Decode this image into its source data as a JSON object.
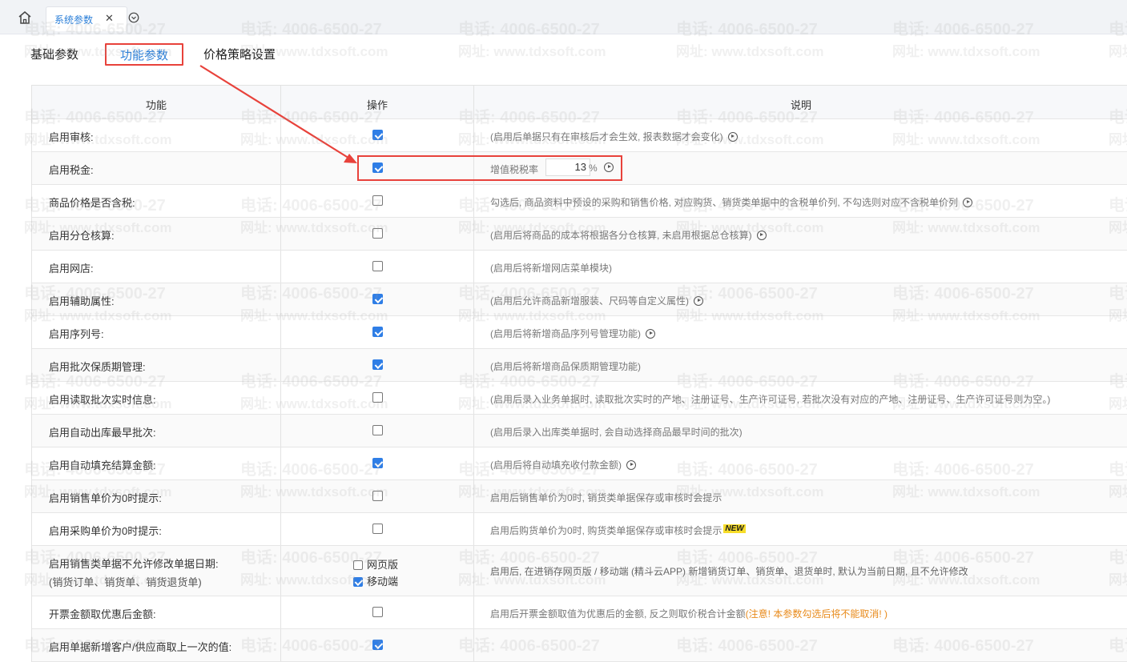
{
  "tabbar": {
    "home_icon": "home-icon",
    "active_tab": "系统参数",
    "close_icon": "close-icon",
    "dropdown_icon": "chevron-down-circle-icon"
  },
  "subtabs": [
    "基础参数",
    "功能参数",
    "价格策略设置"
  ],
  "table": {
    "headers": [
      "功能",
      "操作",
      "说明"
    ],
    "rows": [
      {
        "feature": "启用审核:",
        "checked": true,
        "desc": "(启用后单据只有在审核后才会生效, 报表数据才会变化)",
        "play": true
      },
      {
        "feature": "启用税金:",
        "checked": true,
        "tax_label": "增值税税率",
        "tax_value": "13",
        "tax_unit": "%",
        "play": true
      },
      {
        "feature": "商品价格是否含税:",
        "checked": false,
        "desc": "勾选后, 商品资料中预设的采购和销售价格, 对应购货、销货类单据中的含税单价列, 不勾选则对应不含税单价列",
        "play": true
      },
      {
        "feature": "启用分仓核算:",
        "checked": false,
        "desc": "(启用后将商品的成本将根据各分仓核算, 未启用根据总仓核算)",
        "play": true
      },
      {
        "feature": "启用网店:",
        "checked": false,
        "desc": "(启用后将新增网店菜单模块)",
        "play": false
      },
      {
        "feature": "启用辅助属性:",
        "checked": true,
        "desc": "(启用后允许商品新增服装、尺码等自定义属性)",
        "play": true
      },
      {
        "feature": "启用序列号:",
        "checked": true,
        "desc": "(启用后将新增商品序列号管理功能)",
        "play": true
      },
      {
        "feature": "启用批次保质期管理:",
        "checked": true,
        "desc": "(启用后将新增商品保质期管理功能)",
        "play": false
      },
      {
        "feature": "启用读取批次实时信息:",
        "checked": false,
        "desc": "(启用后录入业务单据时, 读取批次实时的产地、注册证号、生产许可证号, 若批次没有对应的产地、注册证号、生产许可证号则为空。)",
        "play": false
      },
      {
        "feature": "启用自动出库最早批次:",
        "checked": false,
        "desc": "(启用后录入出库类单据时, 会自动选择商品最早时间的批次)",
        "play": false
      },
      {
        "feature": "启用自动填充结算金额:",
        "checked": true,
        "desc": "(启用后将自动填充收付款金额)",
        "play": true
      },
      {
        "feature": "启用销售单价为0时提示:",
        "checked": false,
        "desc": "启用后销售单价为0时, 销货类单据保存或审核时会提示",
        "play": false
      },
      {
        "feature": "启用采购单价为0时提示:",
        "checked": false,
        "desc": "启用后购货单价为0时, 购货类单据保存或审核时会提示",
        "new_badge": "NEW",
        "play": false
      },
      {
        "feature": "启用销售类单据不允许修改单据日期:",
        "feature_sub": "(销货订单、销货单、销货退货单)",
        "options": [
          {
            "label": "网页版",
            "checked": false
          },
          {
            "label": "移动端",
            "checked": true
          }
        ],
        "desc": "启用后, 在进销存网页版 / 移动端 (精斗云APP) 新增销货订单、销货单、退货单时, 默认为当前日期, 且不允许修改"
      },
      {
        "feature": "开票金额取优惠后金额:",
        "checked": false,
        "desc": "启用后开票金额取值为优惠后的金额, 反之则取价税合计金额",
        "warning": "(注意! 本参数勾选后将不能取消! )"
      },
      {
        "feature": "启用单据新增客户/供应商取上一次的值:",
        "checked": true,
        "desc": ""
      }
    ]
  },
  "watermark": {
    "phone": "电话: 4006-6500-27",
    "site": "网址: www.tdxsoft.com"
  },
  "colors": {
    "accent": "#2b7fd8",
    "highlight": "#e8423b",
    "checkbox": "#2f7ee6",
    "warning": "#e88a1a"
  }
}
